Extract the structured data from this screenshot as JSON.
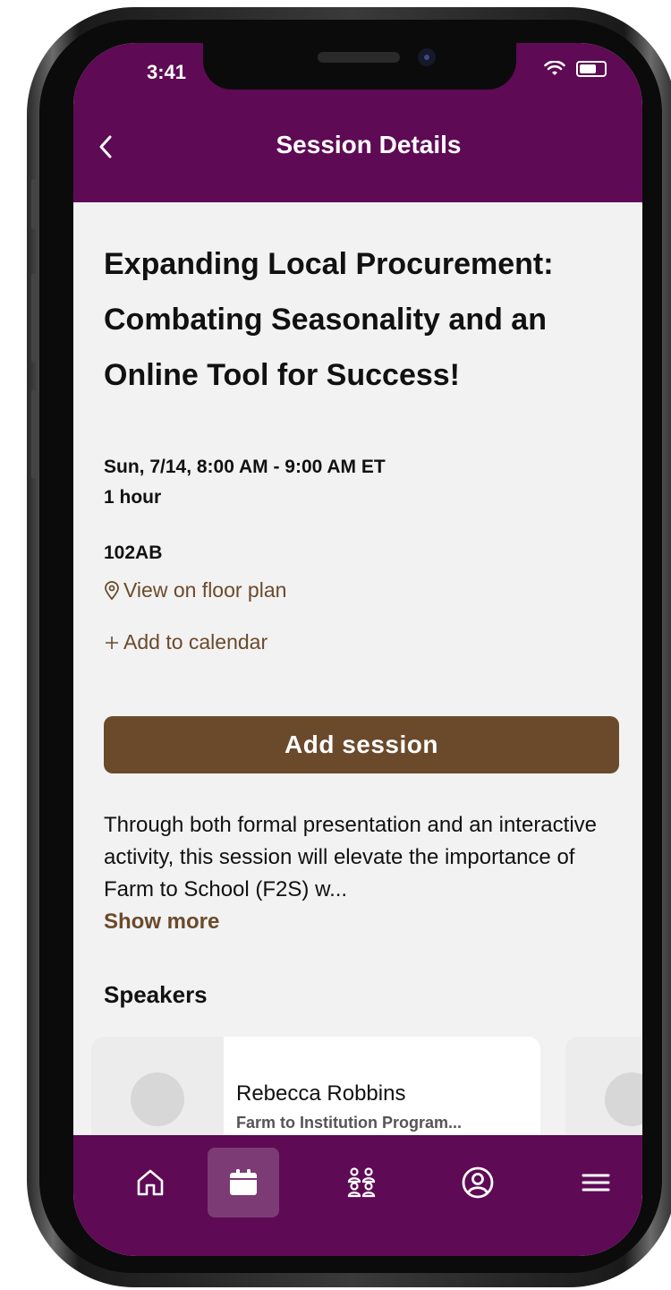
{
  "status_bar": {
    "time": "3:41"
  },
  "header": {
    "title": "Session Details"
  },
  "session": {
    "title": "Expanding Local Procurement: Combating Seasonality and an Online Tool for Success!",
    "datetime": "Sun, 7/14, 8:00 AM - 9:00 AM ET",
    "duration": "1 hour",
    "room": "102AB",
    "floor_plan_link": "View on floor plan",
    "calendar_link": "Add to calendar",
    "add_button": "Add session",
    "description": "Through both formal presentation and an interactive activity, this session will elevate the importance of Farm to School (F2S) w...",
    "show_more": "Show more"
  },
  "speakers": {
    "heading": "Speakers",
    "items": [
      {
        "name": "Rebecca Robbins",
        "org": "Farm to Institution Program..."
      }
    ]
  },
  "bottom_nav": {
    "items": [
      {
        "icon": "home-icon",
        "active": false
      },
      {
        "icon": "calendar-icon",
        "active": true
      },
      {
        "icon": "people-icon",
        "active": false
      },
      {
        "icon": "profile-icon",
        "active": false
      },
      {
        "icon": "menu-icon",
        "active": false
      }
    ]
  },
  "colors": {
    "header": "#5e0a55",
    "accent_brown": "#6b4a2b",
    "nav_active": "#7c3b75",
    "content_bg": "#f2f2f2"
  }
}
